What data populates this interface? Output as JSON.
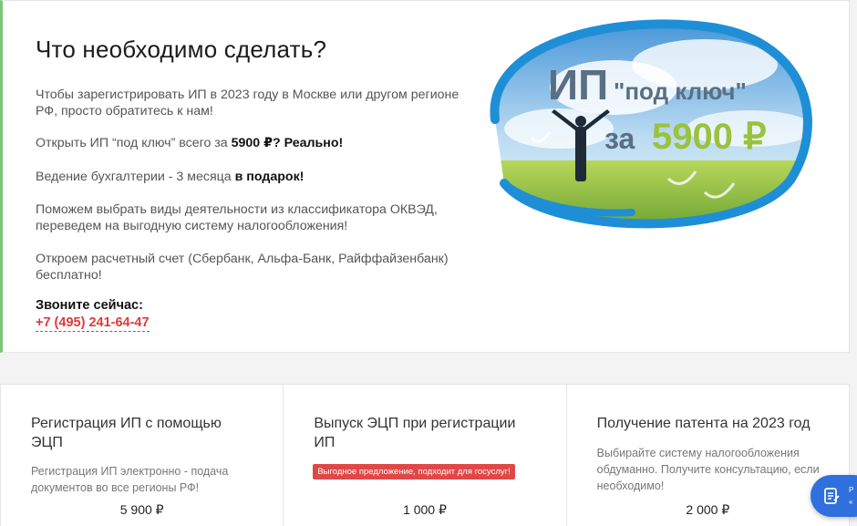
{
  "info": {
    "title": "Что необходимо сделать?",
    "p1": "Чтобы зарегистрировать ИП в 2023 году в Москве или другом регионе РФ, просто обратитесь к нам!",
    "p2_prefix": "Открыть ИП “под ключ” всего за ",
    "p2_bold": "5900 ₽? Реально!",
    "p3_prefix": "Ведение бухгалтерии - 3 месяца ",
    "p3_bold": "в подарок!",
    "p4": "Поможем выбрать виды деятельности из классификатора ОКВЭД, переведем на выгодную систему налогообложения!",
    "p5": "Откроем расчетный счет (Сбербанк, Альфа-Банк, Райффайзенбанк) бесплатно!",
    "call_label": "Звоните сейчас:",
    "phone": "+7 (495) 241-64-47"
  },
  "banner": {
    "line1_big": "ИП",
    "line1_quote": "\"под ключ\"",
    "line2_za": "за",
    "line2_price": "5900 ₽"
  },
  "cards": [
    {
      "title": "Регистрация ИП с помощью ЭЦП",
      "desc": "Регистрация ИП электронно - подача документов во все регионы РФ!",
      "price": "5 900 ₽"
    },
    {
      "title": "Выпуск ЭЦП при регистрации ИП",
      "badge": "Выгодное предложение, подходит для госуслуг!",
      "price": "1 000 ₽"
    },
    {
      "title": "Получение патента на 2023 год",
      "desc": "Выбирайте систему налогообложения обдуманно. Получите консультацию, если необходимо!",
      "price": "2 000 ₽"
    }
  ],
  "chat": {
    "line1": "Р",
    "line2": "«"
  },
  "colors": {
    "accent_green": "#7cc576",
    "phone_red": "#e03a3a",
    "badge_red": "#e04848",
    "chat_blue": "#2f6fde"
  }
}
